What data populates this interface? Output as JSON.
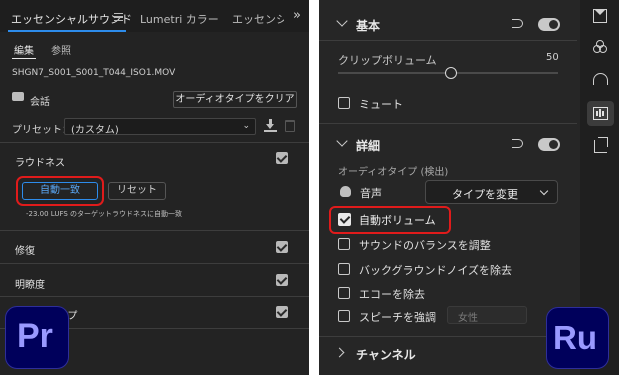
{
  "left": {
    "tabs": [
      "エッセンシャルサウンド",
      "Lumetri カラー",
      "エッセンシ"
    ],
    "subtabs": [
      "編集",
      "参照"
    ],
    "filename": "SHGN7_S001_S001_T044_ISO1.MOV",
    "clip_type": "会話",
    "clear_button": "オーディオタイプをクリア",
    "preset_label": "プリセット：",
    "preset_value": "(カスタム)",
    "loudness_label": "ラウドネス",
    "auto_match_button": "自動一致",
    "reset_button": "リセット",
    "loudness_note": "-23.00 LUFS のターゲットラウドネスに自動一致",
    "sections": [
      "修復",
      "明瞭度",
      "ープ"
    ],
    "logo": "Pr"
  },
  "right": {
    "basic_title": "基本",
    "clip_volume_label": "クリップボリューム",
    "clip_volume_value": "50",
    "mute_label": "ミュート",
    "details_title": "詳細",
    "audio_type_label": "オーディオタイプ (検出)",
    "voice_label": "音声",
    "change_type_button": "タイプを変更",
    "options": [
      "自動ボリューム",
      "サウンドのバランスを調整",
      "バックグラウンドノイズを除去",
      "エコーを除去",
      "スピーチを強調"
    ],
    "speech_gender": "女性",
    "channel_title": "チャンネル",
    "logo": "Ru",
    "slider_level": 0.5
  },
  "colors": {
    "pr_logo_bg": "#00005b",
    "pr_logo_text": "#9999ff",
    "highlight": "#e01b1b",
    "blue_tab": "#2d8ceb"
  }
}
